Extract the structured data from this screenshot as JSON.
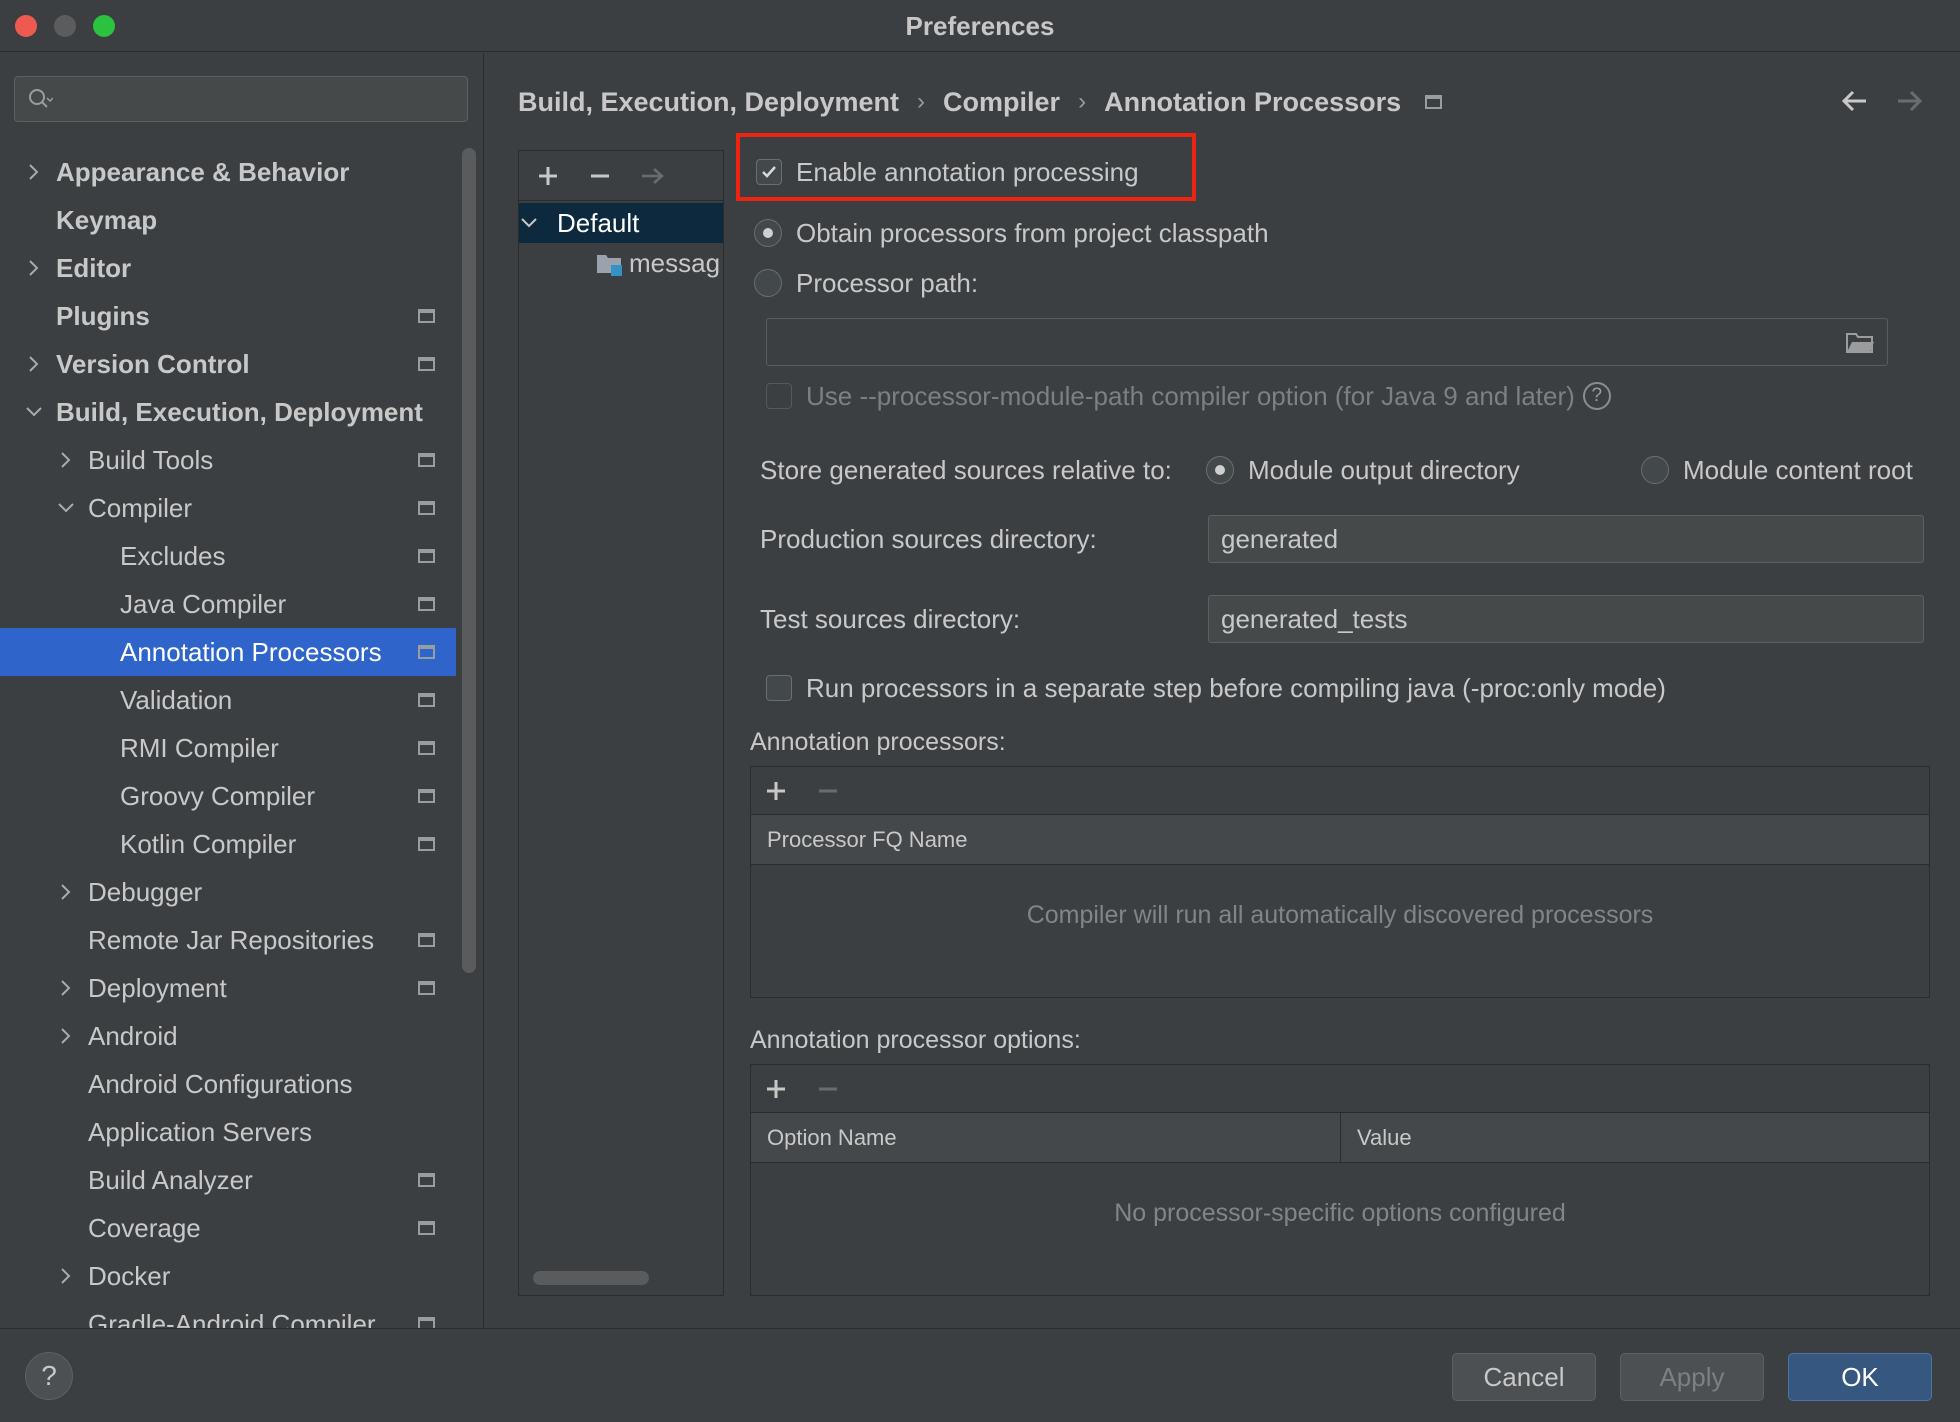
{
  "window": {
    "title": "Preferences"
  },
  "search": {
    "placeholder": ""
  },
  "sidebar": {
    "items": [
      {
        "label": "Appearance & Behavior",
        "bold": true,
        "level": 0,
        "chevron": "right",
        "proj": false
      },
      {
        "label": "Keymap",
        "bold": true,
        "level": 0,
        "chevron": "none",
        "proj": false
      },
      {
        "label": "Editor",
        "bold": true,
        "level": 0,
        "chevron": "right",
        "proj": false
      },
      {
        "label": "Plugins",
        "bold": true,
        "level": 0,
        "chevron": "none",
        "proj": true
      },
      {
        "label": "Version Control",
        "bold": true,
        "level": 0,
        "chevron": "right",
        "proj": true
      },
      {
        "label": "Build, Execution, Deployment",
        "bold": true,
        "level": 0,
        "chevron": "down",
        "proj": false
      },
      {
        "label": "Build Tools",
        "bold": false,
        "level": 1,
        "chevron": "right",
        "proj": true
      },
      {
        "label": "Compiler",
        "bold": false,
        "level": 1,
        "chevron": "down",
        "proj": true
      },
      {
        "label": "Excludes",
        "bold": false,
        "level": 2,
        "chevron": "none",
        "proj": true
      },
      {
        "label": "Java Compiler",
        "bold": false,
        "level": 2,
        "chevron": "none",
        "proj": true
      },
      {
        "label": "Annotation Processors",
        "bold": false,
        "level": 2,
        "chevron": "none",
        "proj": true,
        "selected": true
      },
      {
        "label": "Validation",
        "bold": false,
        "level": 2,
        "chevron": "none",
        "proj": true
      },
      {
        "label": "RMI Compiler",
        "bold": false,
        "level": 2,
        "chevron": "none",
        "proj": true
      },
      {
        "label": "Groovy Compiler",
        "bold": false,
        "level": 2,
        "chevron": "none",
        "proj": true
      },
      {
        "label": "Kotlin Compiler",
        "bold": false,
        "level": 2,
        "chevron": "none",
        "proj": true
      },
      {
        "label": "Debugger",
        "bold": false,
        "level": 1,
        "chevron": "right",
        "proj": false
      },
      {
        "label": "Remote Jar Repositories",
        "bold": false,
        "level": 1,
        "chevron": "none",
        "proj": true
      },
      {
        "label": "Deployment",
        "bold": false,
        "level": 1,
        "chevron": "right",
        "proj": true
      },
      {
        "label": "Android",
        "bold": false,
        "level": 1,
        "chevron": "right",
        "proj": false
      },
      {
        "label": "Android Configurations",
        "bold": false,
        "level": 1,
        "chevron": "none",
        "proj": false
      },
      {
        "label": "Application Servers",
        "bold": false,
        "level": 1,
        "chevron": "none",
        "proj": false
      },
      {
        "label": "Build Analyzer",
        "bold": false,
        "level": 1,
        "chevron": "none",
        "proj": true
      },
      {
        "label": "Coverage",
        "bold": false,
        "level": 1,
        "chevron": "none",
        "proj": true
      },
      {
        "label": "Docker",
        "bold": false,
        "level": 1,
        "chevron": "right",
        "proj": false
      },
      {
        "label": "Gradle-Android Compiler",
        "bold": false,
        "level": 1,
        "chevron": "none",
        "proj": true
      }
    ]
  },
  "breadcrumb": {
    "items": [
      "Build, Execution, Deployment",
      "Compiler",
      "Annotation Processors"
    ],
    "separator": "›"
  },
  "profiles": {
    "default_label": "Default",
    "module_label": "messag"
  },
  "settings": {
    "enable_label": "Enable annotation processing",
    "enable_checked": true,
    "obtain_label": "Obtain processors from project classpath",
    "processor_path_label": "Processor path:",
    "processor_path_value": "",
    "module_path_label": "Use --processor-module-path compiler option (for Java 9 and later)",
    "help_glyph": "?",
    "store_label": "Store generated sources relative to:",
    "store_option_1": "Module output directory",
    "store_option_2": "Module content root",
    "production_label": "Production sources directory:",
    "production_value": "generated",
    "test_label": "Test sources directory:",
    "test_value": "generated_tests",
    "separate_step_label": "Run processors in a separate step before compiling java (-proc:only mode)"
  },
  "processors_table": {
    "section_label": "Annotation processors:",
    "column": "Processor FQ Name",
    "empty_text": "Compiler will run all automatically discovered processors"
  },
  "options_table": {
    "section_label": "Annotation processor options:",
    "columns": [
      "Option Name",
      "Value"
    ],
    "empty_text": "No processor-specific options configured"
  },
  "footer": {
    "help_glyph": "?",
    "cancel_label": "Cancel",
    "apply_label": "Apply",
    "ok_label": "OK"
  },
  "colors": {
    "selection": "#2f65ca",
    "highlight_box": "#ee2412",
    "primary_button": "#365880",
    "close": "#ee5a52",
    "maximize": "#2ac23e"
  }
}
